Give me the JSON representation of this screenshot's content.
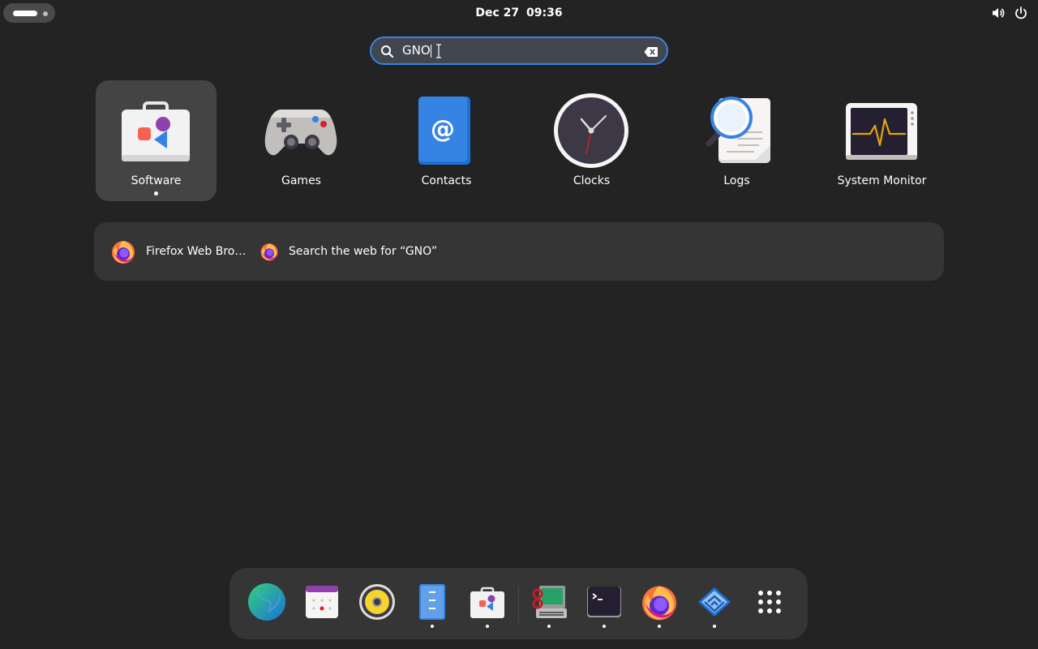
{
  "topbar": {
    "activities_label": "Activities",
    "date": "Dec 27",
    "time": "09:36",
    "volume_icon": "volume-icon",
    "power_icon": "power-icon"
  },
  "search": {
    "value": "GNO",
    "icon": "search-icon",
    "clear_icon": "clear-icon"
  },
  "apps": [
    {
      "label": "Software",
      "icon": "software-icon",
      "selected": true,
      "running": true
    },
    {
      "label": "Games",
      "icon": "games-icon",
      "selected": false,
      "running": false
    },
    {
      "label": "Contacts",
      "icon": "contacts-icon",
      "selected": false,
      "running": false
    },
    {
      "label": "Clocks",
      "icon": "clocks-icon",
      "selected": false,
      "running": false
    },
    {
      "label": "Logs",
      "icon": "logs-icon",
      "selected": false,
      "running": false
    },
    {
      "label": "System Monitor",
      "icon": "system-monitor-icon",
      "selected": false,
      "running": false
    }
  ],
  "provider": {
    "app_label": "Firefox Web Bro…",
    "web_search_label": "Search the web for “GNO”",
    "icon": "firefox-icon"
  },
  "dock": [
    {
      "name": "web-browser-icon",
      "running": false
    },
    {
      "name": "calendar-icon",
      "running": false
    },
    {
      "name": "rhythmbox-icon",
      "running": false
    },
    {
      "name": "files-icon",
      "running": true
    },
    {
      "name": "software-icon",
      "running": true
    },
    {
      "name": "settings-icon",
      "running": true
    },
    {
      "name": "terminal-icon",
      "running": true
    },
    {
      "name": "firefox-icon",
      "running": true
    },
    {
      "name": "maze-game-icon",
      "running": true
    },
    {
      "name": "show-apps-icon",
      "running": false
    }
  ],
  "colors": {
    "background": "#232323",
    "accent": "#3584e4",
    "panel": "#353535",
    "selected": "#444444"
  }
}
